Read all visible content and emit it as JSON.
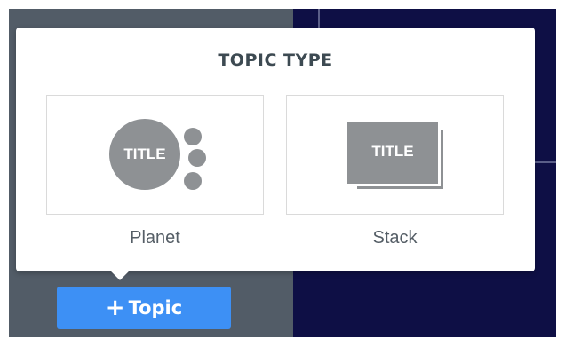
{
  "popover": {
    "title": "TOPIC TYPE",
    "options": [
      {
        "label": "Planet",
        "icon": "planet-icon",
        "icon_text": "TITLE"
      },
      {
        "label": "Stack",
        "icon": "stack-icon",
        "icon_text": "TITLE"
      }
    ]
  },
  "toolbar": {
    "add_topic_label": "Topic",
    "add_topic_icon": "plus-icon",
    "button_color": "#3d90f5"
  },
  "colors": {
    "left_panel": "#525c67",
    "canvas": "#0e0f45",
    "icon_gray": "#8e9194"
  }
}
